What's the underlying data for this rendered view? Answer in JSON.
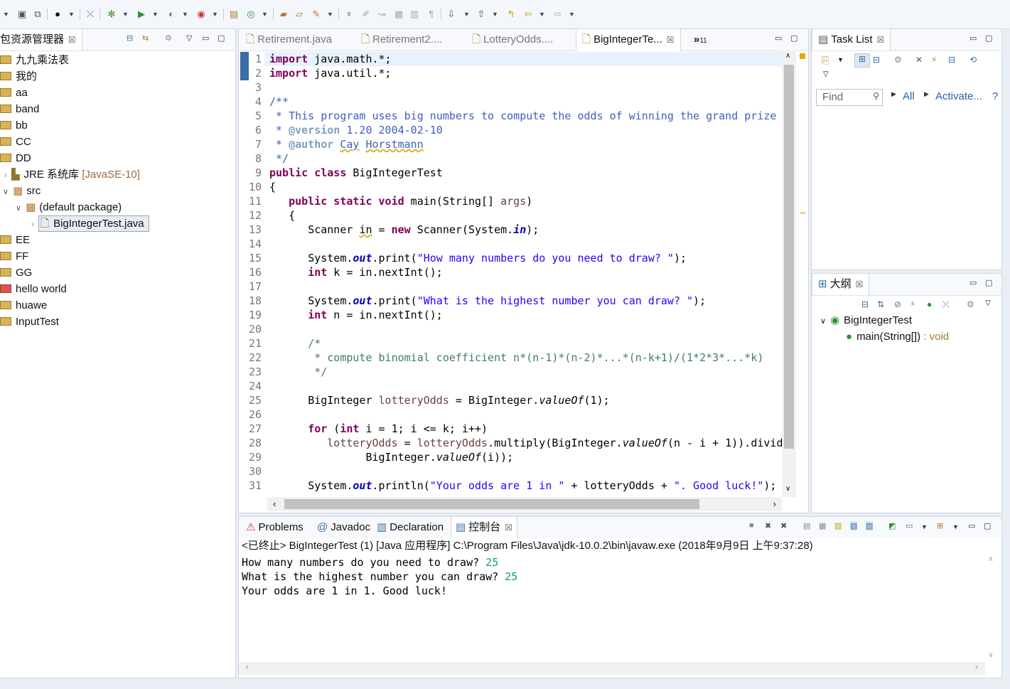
{
  "toolbar": {
    "icons": [
      "new-icon",
      "save-icon",
      "save-all-icon",
      "skip-breakpoints-icon",
      "debug-icon",
      "run-icon",
      "coverage-icon",
      "external-tools-icon",
      "new-java-project-icon",
      "new-package-icon",
      "new-class-icon",
      "open-type-icon",
      "open-task-icon",
      "search-icon",
      "pin-icon",
      "annotation-icon",
      "toggle-mark-icon",
      "show-whitespace-icon",
      "next-annotation-icon",
      "prev-annotation-icon",
      "last-edit-icon",
      "back-icon",
      "forward-icon"
    ]
  },
  "explorer": {
    "title": "包资源管理器",
    "items": [
      {
        "label": "九九乘法表"
      },
      {
        "label": "我的"
      },
      {
        "label": "aa"
      },
      {
        "label": "band"
      },
      {
        "label": "bb"
      },
      {
        "label": "CC"
      },
      {
        "label": "DD"
      },
      {
        "label": "JRE 系统库",
        "suffix": "[JavaSE-10]"
      },
      {
        "label": "src"
      },
      {
        "label": "(default package)"
      },
      {
        "label": "BigIntegerTest.java"
      },
      {
        "label": "EE"
      },
      {
        "label": "FF"
      },
      {
        "label": "GG"
      },
      {
        "label": "hello world"
      },
      {
        "label": "huawe"
      },
      {
        "label": "InputTest"
      }
    ]
  },
  "editor": {
    "tabs": [
      {
        "label": "Retirement.java"
      },
      {
        "label": "Retirement2...."
      },
      {
        "label": "LotteryOdds...."
      },
      {
        "label": "BigIntegerTe..."
      }
    ],
    "overflow_label": "»",
    "overflow_count": "11",
    "line_numbers": [
      "1",
      "2",
      "3",
      "4",
      "5",
      "6",
      "7",
      "8",
      "9",
      "10",
      "11",
      "12",
      "13",
      "14",
      "15",
      "16",
      "17",
      "18",
      "19",
      "20",
      "21",
      "22",
      "23",
      "24",
      "25",
      "26",
      "27",
      "28",
      "29",
      "30",
      "31"
    ],
    "lines": {
      "l1_kw": "import",
      "l1_rest": " java.math.*;",
      "l2_kw": "import",
      "l2_rest": " java.util.*;",
      "l4": "/**",
      "l5": " * This program uses big numbers to compute the odds of winning the grand prize",
      "l6_tag": "@version",
      "l6_rest": " 1.20 2004-02-10",
      "l7_tag": "@author",
      "l7_n1": "Cay",
      "l7_n2": "Horstmann",
      "l8": " */",
      "l9_kw": "public class",
      "l9_rest": " BigIntegerTest",
      "l10": "{",
      "l11_kw": "public static void",
      "l11_m": " main(String[] ",
      "l11_var": "args",
      "l11_end": ")",
      "l12": "{",
      "l13_a": "Scanner ",
      "l13_in": "in",
      "l13_b": " = ",
      "l13_new": "new",
      "l13_c": " Scanner(System.",
      "l13_fld": "in",
      "l13_d": ");",
      "l15_a": "System.",
      "l15_out": "out",
      "l15_b": ".print(",
      "l15_str": "\"How many numbers do you need to draw? \"",
      "l15_c": ");",
      "l16_kw": "int",
      "l16_rest": " k = in.nextInt();",
      "l18_a": "System.",
      "l18_out": "out",
      "l18_b": ".print(",
      "l18_str": "\"What is the highest number you can draw? \"",
      "l18_c": ");",
      "l19_kw": "int",
      "l19_rest": " n = in.nextInt();",
      "l21": "/*",
      "l22": " * compute binomial coefficient n*(n-1)*(n-2)*...*(n-k+1)/(1*2*3*...*k)",
      "l23": " */",
      "l25_a": "BigInteger ",
      "l25_var": "lotteryOdds",
      "l25_b": " = BigInteger.",
      "l25_st": "valueOf",
      "l25_c": "(1);",
      "l27_kw": "for",
      "l27_a": " (",
      "l27_int": "int",
      "l27_b": " i = 1; i <= k; i++)",
      "l28_var": "lotteryOdds",
      "l28_a": " = ",
      "l28_var2": "lotteryOdds",
      "l28_b": ".multiply(BigInteger.",
      "l28_st": "valueOf",
      "l28_c": "(n - i + 1)).divid",
      "l29_a": "BigInteger.",
      "l29_st": "valueOf",
      "l29_b": "(i));",
      "l31_a": "System.",
      "l31_out": "out",
      "l31_b": ".println(",
      "l31_str1": "\"Your odds are 1 in \"",
      "l31_c": " + lotteryOdds + ",
      "l31_str2": "\". Good luck!\"",
      "l31_d": ");"
    }
  },
  "tasklist": {
    "title": "Task List",
    "find_placeholder": "Find",
    "all_label": "All",
    "activate_label": "Activate..."
  },
  "outline": {
    "title": "大纲",
    "class_name": "BigIntegerTest",
    "method": "main(String[])",
    "method_type": " : void"
  },
  "console": {
    "tabs": [
      {
        "label": "Problems"
      },
      {
        "label": "Javadoc"
      },
      {
        "label": "Declaration"
      },
      {
        "label": "控制台"
      }
    ],
    "header": "<已终止> BigIntegerTest (1)  [Java 应用程序] C:\\Program Files\\Java\\jdk-10.0.2\\bin\\javaw.exe (2018年9月9日 上午9:37:28)",
    "line1": "How many numbers do you need to draw? ",
    "input1": "25",
    "line2": "What is the highest number you can draw? ",
    "input2": "25",
    "line3": "Your odds are 1 in 1. Good luck!"
  }
}
